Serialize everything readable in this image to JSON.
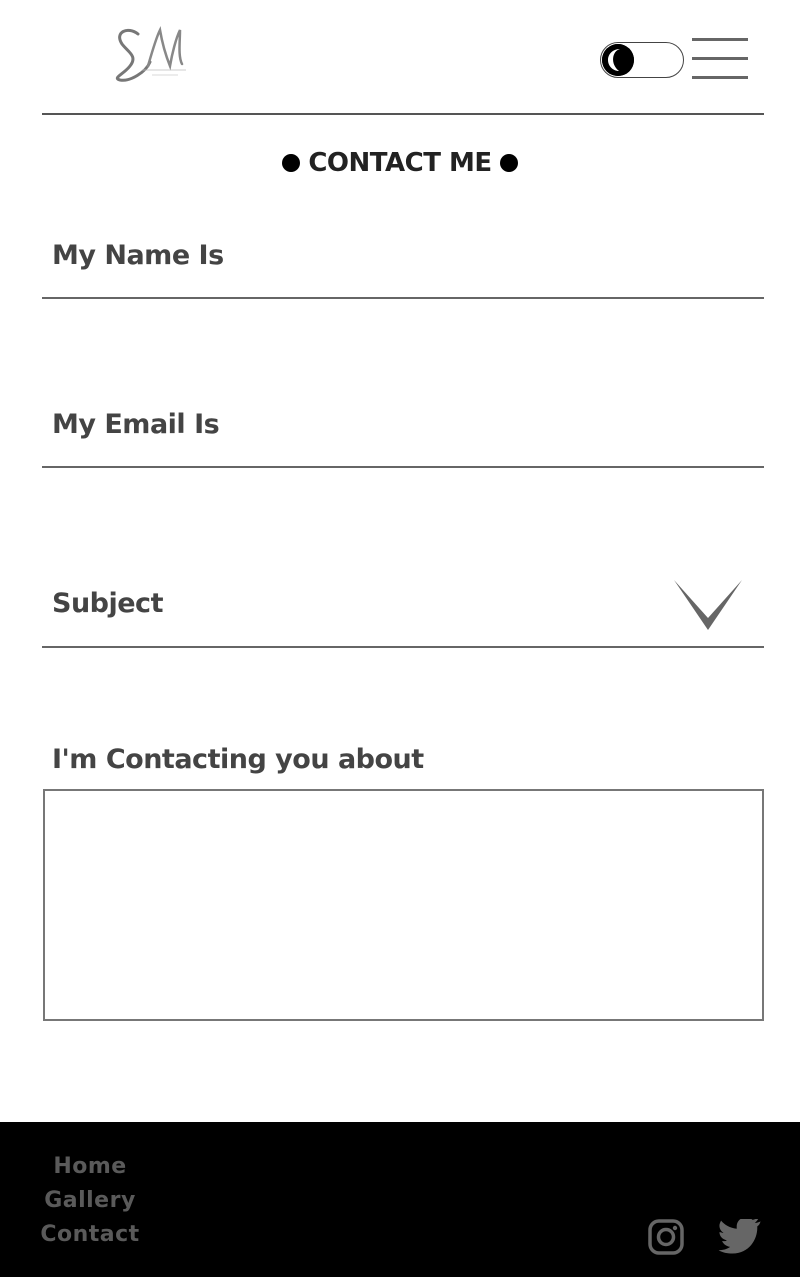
{
  "header": {
    "logo_text": "SN",
    "logo_subtext": "SAM NIXON",
    "theme_toggle_icon": "moon-icon",
    "menu_icon": "hamburger-menu-icon"
  },
  "title": "CONTACT ME",
  "form": {
    "name_label": "My Name Is",
    "email_label": "My Email Is",
    "subject_label": "Subject",
    "subject_icon": "chevron-down-icon",
    "message_label": "I'm Contacting you about"
  },
  "footer": {
    "links": [
      "Home",
      "Gallery",
      "Contact"
    ],
    "social_icons": [
      "instagram-icon",
      "twitter-icon"
    ]
  },
  "colors": {
    "text": "#333333",
    "footer_bg": "#000000",
    "footer_link": "#5a5a5a",
    "icon_gray": "#666666"
  }
}
